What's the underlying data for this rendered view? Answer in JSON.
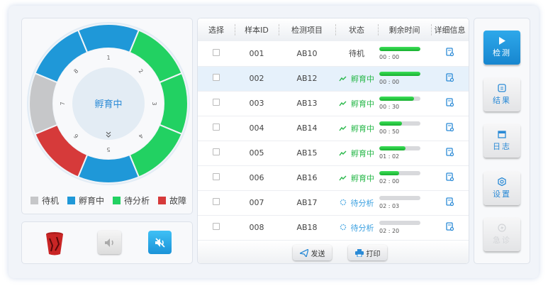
{
  "ring": {
    "center_label": "孵育中",
    "slots": [
      {
        "num": "1",
        "status": "incubating"
      },
      {
        "num": "2",
        "status": "pending"
      },
      {
        "num": "3",
        "status": "pending"
      },
      {
        "num": "4",
        "status": "pending"
      },
      {
        "num": "5",
        "status": "incubating"
      },
      {
        "num": "6",
        "status": "fault"
      },
      {
        "num": "7",
        "status": "standby"
      },
      {
        "num": "8",
        "status": "incubating"
      }
    ],
    "colors": {
      "standby": "#c6c7c9",
      "incubating": "#1f98d8",
      "pending": "#22d162",
      "fault": "#d63a3a"
    }
  },
  "legend": [
    {
      "label": "待机",
      "color": "#c6c7c9"
    },
    {
      "label": "孵育中",
      "color": "#1f98d8"
    },
    {
      "label": "待分析",
      "color": "#22d162"
    },
    {
      "label": "故障",
      "color": "#d63a3a"
    }
  ],
  "table": {
    "headers": [
      "选择",
      "样本ID",
      "检测项目",
      "状态",
      "剩余时间",
      "详细信息"
    ],
    "rows": [
      {
        "id": "001",
        "item": "AB10",
        "status": "待机",
        "kind": "standby",
        "progress": 100,
        "time": "00 : 00"
      },
      {
        "id": "002",
        "item": "AB12",
        "status": "孵育中",
        "kind": "incubating",
        "progress": 100,
        "time": "00 : 00"
      },
      {
        "id": "003",
        "item": "AB13",
        "status": "孵育中",
        "kind": "incubating",
        "progress": 85,
        "time": "00 : 30"
      },
      {
        "id": "004",
        "item": "AB14",
        "status": "孵育中",
        "kind": "incubating",
        "progress": 56,
        "time": "00 : 50"
      },
      {
        "id": "005",
        "item": "AB15",
        "status": "孵育中",
        "kind": "incubating",
        "progress": 63,
        "time": "01 : 02"
      },
      {
        "id": "006",
        "item": "AB16",
        "status": "孵育中",
        "kind": "incubating",
        "progress": 49,
        "time": "02 : 00"
      },
      {
        "id": "007",
        "item": "AB17",
        "status": "待分析",
        "kind": "pending",
        "progress": 0,
        "time": "02 : 03"
      },
      {
        "id": "008",
        "item": "AB18",
        "status": "待分析",
        "kind": "pending",
        "progress": 0,
        "time": "02 : 20"
      }
    ],
    "selected_row": 1
  },
  "footer": {
    "send": "发送",
    "print": "打印"
  },
  "side": {
    "detect": "检测",
    "results": "结果",
    "log": "日志",
    "settings": "设置",
    "emergency": "急诊"
  }
}
